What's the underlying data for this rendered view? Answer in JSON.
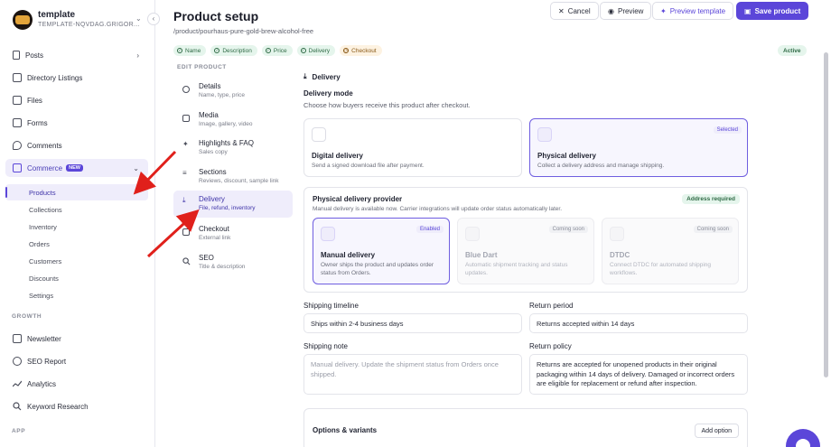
{
  "workspace": {
    "name": "template",
    "subtitle": "TEMPLATE-NQVDAG.GRIGOR..."
  },
  "sidebar": {
    "items": [
      {
        "label": "Posts"
      },
      {
        "label": "Directory Listings"
      },
      {
        "label": "Files"
      },
      {
        "label": "Forms"
      },
      {
        "label": "Comments"
      }
    ],
    "commerce": {
      "label": "Commerce",
      "badge": "NEW",
      "sub": [
        "Products",
        "Collections",
        "Inventory",
        "Orders",
        "Customers",
        "Discounts",
        "Settings"
      ]
    },
    "growth_label": "GROWTH",
    "growth": [
      {
        "label": "Newsletter"
      },
      {
        "label": "SEO Report"
      },
      {
        "label": "Analytics"
      },
      {
        "label": "Keyword Research"
      }
    ],
    "app_label": "APP"
  },
  "header": {
    "title": "Product setup",
    "path": "/product/pourhaus-pure-gold-brew-alcohol-free",
    "cancel": "Cancel",
    "preview": "Preview",
    "preview_template": "Preview template",
    "save": "Save product"
  },
  "steps": [
    {
      "label": "Name",
      "state": "done"
    },
    {
      "label": "Description",
      "state": "done"
    },
    {
      "label": "Price",
      "state": "done"
    },
    {
      "label": "Delivery",
      "state": "done"
    },
    {
      "label": "Checkout",
      "state": "pending"
    }
  ],
  "status": "Active",
  "edit": {
    "label": "EDIT PRODUCT",
    "items": [
      {
        "title": "Details",
        "sub": "Name, type, price"
      },
      {
        "title": "Media",
        "sub": "Image, gallery, video"
      },
      {
        "title": "Highlights & FAQ",
        "sub": "Sales copy"
      },
      {
        "title": "Sections",
        "sub": "Reviews, discount, sample link"
      },
      {
        "title": "Delivery",
        "sub": "File, refund, inventory"
      },
      {
        "title": "Checkout",
        "sub": "External link"
      },
      {
        "title": "SEO",
        "sub": "Title & description"
      }
    ]
  },
  "delivery": {
    "heading": "Delivery",
    "mode_title": "Delivery mode",
    "mode_desc": "Choose how buyers receive this product after checkout.",
    "digital": {
      "title": "Digital delivery",
      "desc": "Send a signed download file after payment."
    },
    "physical": {
      "title": "Physical delivery",
      "desc": "Collect a delivery address and manage shipping.",
      "tag": "Selected"
    },
    "provider": {
      "title": "Physical delivery provider",
      "desc": "Manual delivery is available now. Carrier integrations will update order status automatically later.",
      "required": "Address required",
      "options": [
        {
          "title": "Manual delivery",
          "desc": "Owner ships the product and updates order status from Orders.",
          "tag": "Enabled"
        },
        {
          "title": "Blue Dart",
          "desc": "Automatic shipment tracking and status updates.",
          "tag": "Coming soon"
        },
        {
          "title": "DTDC",
          "desc": "Connect DTDC for automated shipping workflows.",
          "tag": "Coming soon"
        }
      ]
    },
    "shipping_timeline_label": "Shipping timeline",
    "shipping_timeline_value": "Ships within 2-4 business days",
    "return_period_label": "Return period",
    "return_period_value": "Returns accepted within 14 days",
    "shipping_note_label": "Shipping note",
    "shipping_note_placeholder": "Manual delivery. Update the shipment status from Orders once shipped.",
    "return_policy_label": "Return policy",
    "return_policy_value": "Returns are accepted for unopened products in their original packaging within 14 days of delivery. Damaged or incorrect orders are eligible for replacement or refund after inspection."
  },
  "options": {
    "title": "Options & variants",
    "add": "Add option"
  },
  "colors": {
    "accent": "#5b46d9",
    "annotation": "#e0201b"
  }
}
